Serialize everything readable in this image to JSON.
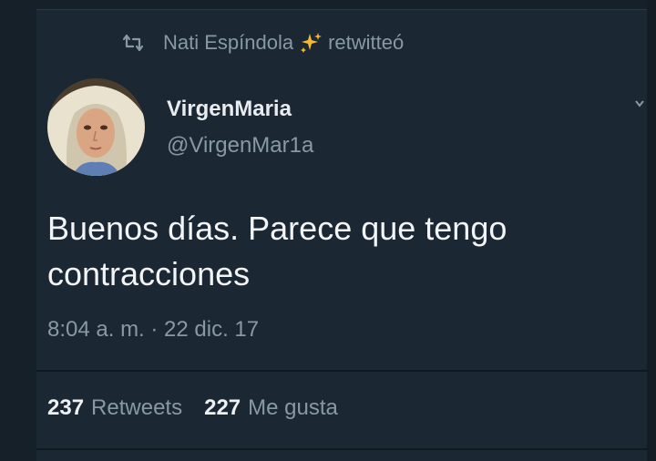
{
  "retweet": {
    "user": "Nati Espíndola",
    "suffix": "retwitteó",
    "icon": "retweet-icon",
    "emoji": "sparkle-icon"
  },
  "tweet": {
    "display_name": "VirgenMaria",
    "handle": "@VirgenMar1a",
    "text_line1": "Buenos días. Parece que tengo",
    "text_line2": "contracciones",
    "timestamp": "8:04 a. m. · 22 dic. 17"
  },
  "stats": {
    "retweets_count": "237",
    "retweets_label": "Retweets",
    "likes_count": "227",
    "likes_label": "Me gusta"
  },
  "colors": {
    "background": "#162029",
    "card": "#1b2733",
    "text_primary": "#f2f4f6",
    "text_secondary": "#8899a6",
    "sparkle": "#f5b82e"
  }
}
